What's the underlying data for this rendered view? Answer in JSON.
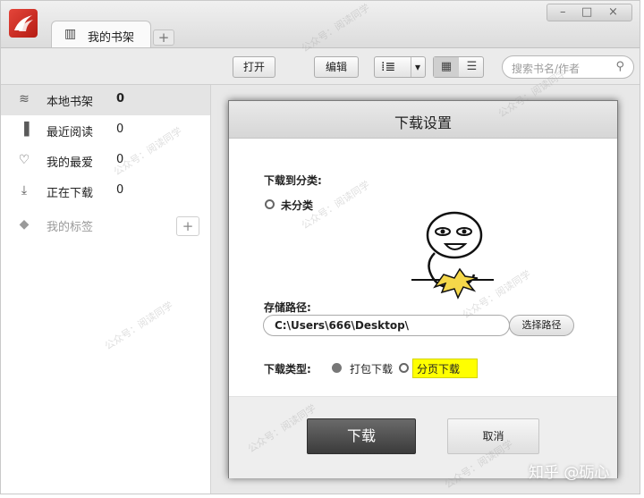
{
  "titlebar": {
    "tab_label": "我的书架",
    "tab_add": "+",
    "window_controls": {
      "minimize": "–",
      "maximize": "□",
      "close": "×"
    }
  },
  "toolbar": {
    "open_label": "打开",
    "edit_label": "编辑",
    "sort_icon": "list-sort-icon",
    "sort_dropdown": "▾",
    "search_placeholder": "搜索书名/作者"
  },
  "sidebar": {
    "items": [
      {
        "label": "本地书架",
        "count": "0",
        "icon": "stack-icon"
      },
      {
        "label": "最近阅读",
        "count": "0",
        "icon": "book-icon"
      },
      {
        "label": "我的最爱",
        "count": "0",
        "icon": "heart-icon"
      },
      {
        "label": "正在下载",
        "count": "0",
        "icon": "download-icon"
      },
      {
        "label": "我的标签",
        "icon": "tag-icon"
      }
    ],
    "add_tag": "+"
  },
  "dialog": {
    "title": "下载设置",
    "category_label": "下载到分类:",
    "category_option": "未分类",
    "path_label": "存储路径:",
    "path_value": "C:\\Users\\666\\Desktop\\",
    "choose_path_label": "选择路径",
    "type_label": "下载类型:",
    "type_option_1": "打包下载",
    "type_option_2": "分页下载",
    "download_button": "下载",
    "cancel_button": "取消"
  },
  "watermark_text": "公众号：阅读同学",
  "attribution": "知乎 @砺心",
  "colors": {
    "highlight": "#ffff00",
    "download_button": "#4a4a4a",
    "logo": "#d1332a"
  }
}
